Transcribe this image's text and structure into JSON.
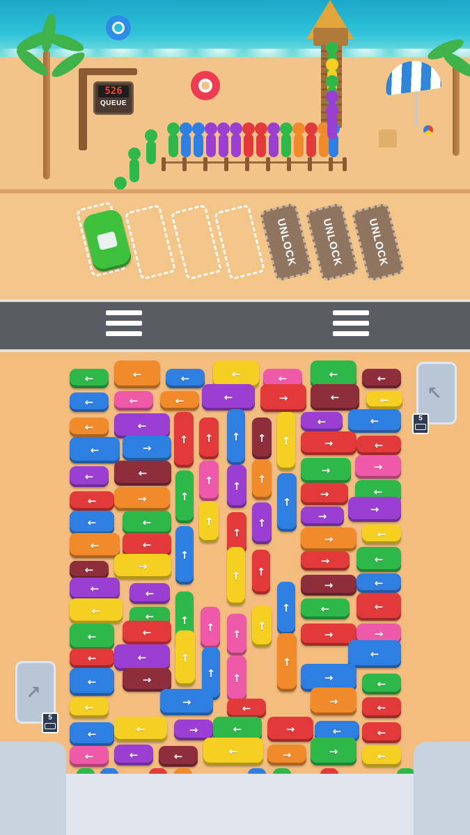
{
  "queue": {
    "count": "526",
    "label": "QUEUE"
  },
  "slots": {
    "locked_label": "UNLOCK",
    "open_count": 4,
    "locked_count": 3
  },
  "exits": [
    {
      "count": "5"
    },
    {
      "count": "5"
    }
  ],
  "colors": {
    "green": "#2fb84a",
    "blue": "#2f7fe3",
    "purple": "#9a3fd1",
    "red": "#e23a3a",
    "orange": "#f08a2a",
    "yellow": "#f5d023",
    "pink": "#ef5aa8",
    "maroon": "#8e2e3c",
    "lime": "#57cf3c",
    "sand": "#f3bd80",
    "sea": "#1aa7c8",
    "road": "#5a5c63"
  },
  "queue_people_colors": [
    "green",
    "blue",
    "blue",
    "purple",
    "purple",
    "purple",
    "red",
    "red",
    "purple",
    "green",
    "orange",
    "red",
    "orange",
    "blue"
  ],
  "vehicles": [
    {
      "c": "green",
      "d": "left"
    },
    {
      "c": "orange",
      "d": "left"
    },
    {
      "c": "blue",
      "d": "left"
    },
    {
      "c": "yellow",
      "d": "left"
    },
    {
      "c": "pink",
      "d": "left"
    },
    {
      "c": "green",
      "d": "left"
    },
    {
      "c": "maroon",
      "d": "left"
    },
    {
      "c": "blue",
      "d": "left"
    },
    {
      "c": "pink",
      "d": "left"
    },
    {
      "c": "orange",
      "d": "left"
    },
    {
      "c": "purple",
      "d": "left"
    },
    {
      "c": "red",
      "d": "right"
    },
    {
      "c": "maroon",
      "d": "left"
    },
    {
      "c": "yellow",
      "d": "left"
    },
    {
      "c": "orange",
      "d": "left"
    },
    {
      "c": "purple",
      "d": "left"
    },
    {
      "c": "red",
      "d": "up"
    },
    {
      "c": "red",
      "d": "up"
    },
    {
      "c": "blue",
      "d": "up"
    },
    {
      "c": "maroon",
      "d": "up"
    },
    {
      "c": "yellow",
      "d": "up"
    },
    {
      "c": "purple",
      "d": "left"
    },
    {
      "c": "blue",
      "d": "left"
    },
    {
      "c": "blue",
      "d": "left"
    },
    {
      "c": "blue",
      "d": "right"
    },
    {
      "c": "red",
      "d": "right"
    },
    {
      "c": "red",
      "d": "left"
    },
    {
      "c": "purple",
      "d": "left"
    },
    {
      "c": "maroon",
      "d": "left"
    },
    {
      "c": "pink",
      "d": "up"
    },
    {
      "c": "purple",
      "d": "up"
    },
    {
      "c": "orange",
      "d": "up"
    },
    {
      "c": "blue",
      "d": "up"
    },
    {
      "c": "green",
      "d": "right"
    },
    {
      "c": "pink",
      "d": "right"
    },
    {
      "c": "red",
      "d": "left"
    },
    {
      "c": "orange",
      "d": "right"
    },
    {
      "c": "red",
      "d": "right"
    },
    {
      "c": "green",
      "d": "left"
    },
    {
      "c": "blue",
      "d": "left"
    },
    {
      "c": "green",
      "d": "left"
    },
    {
      "c": "green",
      "d": "up"
    },
    {
      "c": "yellow",
      "d": "up"
    },
    {
      "c": "red",
      "d": "up"
    },
    {
      "c": "purple",
      "d": "up"
    },
    {
      "c": "purple",
      "d": "right"
    },
    {
      "c": "purple",
      "d": "right"
    },
    {
      "c": "orange",
      "d": "left"
    },
    {
      "c": "red",
      "d": "left"
    },
    {
      "c": "blue",
      "d": "up"
    },
    {
      "c": "red",
      "d": "up"
    },
    {
      "c": "orange",
      "d": "right"
    },
    {
      "c": "yellow",
      "d": "left"
    },
    {
      "c": "yellow",
      "d": "right"
    },
    {
      "c": "maroon",
      "d": "left"
    },
    {
      "c": "yellow",
      "d": "up"
    },
    {
      "c": "red",
      "d": "right"
    },
    {
      "c": "green",
      "d": "left"
    },
    {
      "c": "purple",
      "d": "left"
    },
    {
      "c": "purple",
      "d": "left"
    },
    {
      "c": "green",
      "d": "up"
    },
    {
      "c": "blue",
      "d": "up"
    },
    {
      "c": "maroon",
      "d": "right"
    },
    {
      "c": "blue",
      "d": "left"
    },
    {
      "c": "yellow",
      "d": "left"
    },
    {
      "c": "green",
      "d": "left"
    },
    {
      "c": "pink",
      "d": "up"
    },
    {
      "c": "green",
      "d": "left"
    },
    {
      "c": "red",
      "d": "left"
    },
    {
      "c": "green",
      "d": "left"
    },
    {
      "c": "red",
      "d": "left"
    },
    {
      "c": "pink",
      "d": "up"
    },
    {
      "c": "yellow",
      "d": "up"
    },
    {
      "c": "red",
      "d": "right"
    },
    {
      "c": "pink",
      "d": "right"
    },
    {
      "c": "red",
      "d": "left"
    },
    {
      "c": "purple",
      "d": "left"
    },
    {
      "c": "yellow",
      "d": "up"
    },
    {
      "c": "blue",
      "d": "up"
    },
    {
      "c": "orange",
      "d": "up"
    },
    {
      "c": "blue",
      "d": "left"
    },
    {
      "c": "blue",
      "d": "left"
    },
    {
      "c": "maroon",
      "d": "right"
    },
    {
      "c": "pink",
      "d": "up"
    },
    {
      "c": "blue",
      "d": "right"
    },
    {
      "c": "green",
      "d": "left"
    },
    {
      "c": "yellow",
      "d": "left"
    },
    {
      "c": "blue",
      "d": "right"
    },
    {
      "c": "red",
      "d": "left"
    },
    {
      "c": "orange",
      "d": "right"
    },
    {
      "c": "red",
      "d": "left"
    },
    {
      "c": "blue",
      "d": "left"
    },
    {
      "c": "yellow",
      "d": "left"
    },
    {
      "c": "purple",
      "d": "right"
    },
    {
      "c": "green",
      "d": "left"
    },
    {
      "c": "red",
      "d": "right"
    },
    {
      "c": "blue",
      "d": "left"
    },
    {
      "c": "red",
      "d": "left"
    },
    {
      "c": "pink",
      "d": "left"
    },
    {
      "c": "purple",
      "d": "left"
    },
    {
      "c": "maroon",
      "d": "left"
    },
    {
      "c": "yellow",
      "d": "left"
    },
    {
      "c": "orange",
      "d": "right"
    },
    {
      "c": "green",
      "d": "right"
    },
    {
      "c": "yellow",
      "d": "left"
    },
    {
      "c": "purple",
      "d": "up"
    },
    {
      "c": "green",
      "d": "up"
    },
    {
      "c": "blue",
      "d": "up"
    },
    {
      "c": "maroon",
      "d": "up"
    },
    {
      "c": "red",
      "d": "up"
    },
    {
      "c": "orange",
      "d": "up"
    },
    {
      "c": "purple",
      "d": "up"
    },
    {
      "c": "yellow",
      "d": "up"
    },
    {
      "c": "blue",
      "d": "up"
    },
    {
      "c": "green",
      "d": "up"
    },
    {
      "c": "orange",
      "d": "up"
    },
    {
      "c": "red",
      "d": "up"
    },
    {
      "c": "yellow",
      "d": "up"
    },
    {
      "c": "blue",
      "d": "up"
    },
    {
      "c": "green",
      "d": "up"
    }
  ]
}
